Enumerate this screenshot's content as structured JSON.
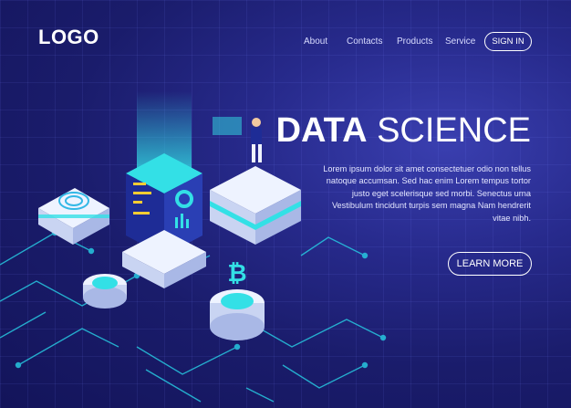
{
  "header": {
    "logo": "LOGO",
    "nav": [
      "About",
      "Contacts",
      "Products",
      "Service"
    ],
    "signin_label": "SIGN IN"
  },
  "hero": {
    "title_bold": "DATA",
    "title_light": "SCIENCE",
    "description": "Lorem ipsum dolor sit amet consectetuer odio non tellus natoque accumsan. Sed hac enim Lorem tempus tortor justo eget scelerisque sed morbi. Senectus urna Vestibulum tincidunt turpis sem magna Nam hendrerit vitae nibh.",
    "cta_label": "LEARN MORE"
  },
  "colors": {
    "background": "#1a1c6b",
    "accent_cyan": "#33e0e6",
    "server_dark": "#202a8a"
  },
  "icons": [
    "server-icon",
    "bitcoin-icon",
    "fingerprint-icon",
    "person-icon",
    "circuit-lines-icon"
  ]
}
